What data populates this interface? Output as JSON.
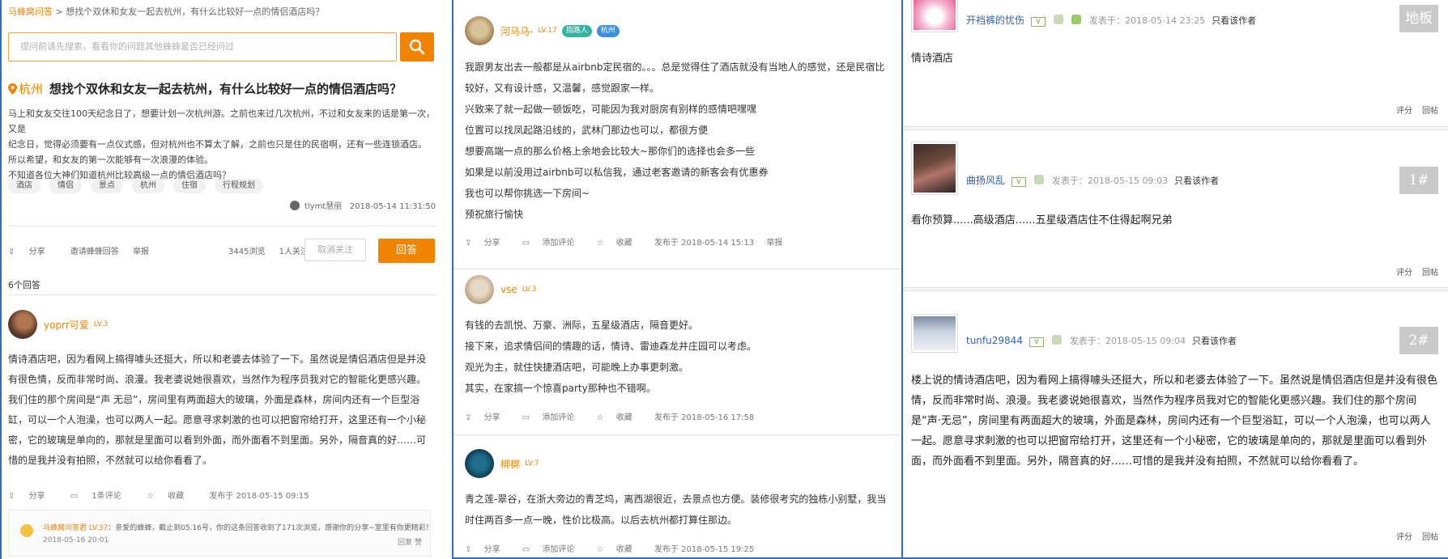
{
  "panel1": {
    "breadcrumb_home": "马蜂窝问答",
    "breadcrumb_rest": " > 想找个双休和女友一起去杭州，有什么比较好一点的情侣酒店吗？",
    "search_placeholder": "提问前请先搜索，看看你的问题其他蜂蜂是否已经问过",
    "question_city": "杭州",
    "question_title": "想找个双休和女友一起去杭州，有什么比较好一点的情侣酒店吗？",
    "question_lines": [
      "马上和女友交往100天纪念日了，想要计划一次杭州游。之前也来过几次杭州，不过和女友来的话是第一次，又是",
      "纪念日，觉得必须要有一点仪式感，但对杭州也不算太了解，之前也只是住的民宿啊，还有一些连锁酒店。",
      "所以希望，和女友的第一次能够有一次浪漫的体验。",
      "不知道各位大神们知道杭州比较高级一点的情侣酒店吗？"
    ],
    "tags": [
      "酒店",
      "情侣",
      "景点",
      "杭州",
      "住宿",
      "行程规划"
    ],
    "asker_name": "tlymt慧丽",
    "asker_time": "2018-05-14 11:31:50",
    "actions": [
      "分享",
      "邀请蜂蜂回答",
      "举报"
    ],
    "views": "3445浏览",
    "followers": "1人关注",
    "unfollow_label": "取消关注",
    "answer_label": "回答",
    "answer_count": "6个回答",
    "answer": {
      "user": "yoprr可爱",
      "level": "LV.3",
      "lines": [
        "情诗酒店吧，因为看网上搞得噱头还挺大，所以和老婆去体验了一下。虽然说是情侣酒店但是并没",
        "有很色情，反而非常时尚、浪漫。我老婆说她很喜欢，当然作为程序员我对它的智能化更感兴趣。",
        "我们住的那个房间是“声 无忌”，房间里有两面超大的玻璃，外面是森林，房间内还有一个巨型浴",
        "缸，可以一个人泡澡，也可以两人一起。愿意寻求刺激的也可以把窗帘给打开，这里还有一个小秘",
        "密，它的玻璃是单向的，那就是里面可以看到外面，而外面看不到里面。另外，隔音真的好……可",
        "惜的是我并没有拍照，不然就可以给你看看了。"
      ],
      "actions": [
        "分享",
        "1条评论",
        "收藏",
        "发布于 2018-05-15 09:15"
      ],
      "reply_name": "马蜂窝问答君",
      "reply_level": "LV.37",
      "reply_text": "：亲爱的蜂蜂，截止到05.16号，你的这条回答收到了171次浏览，感谢你的分享~室里有你更精彩！",
      "reply_date": "2018-05-16 20:01",
      "reply_ops": "回复  赞"
    }
  },
  "panel2": {
    "answers": [
      {
        "user": "河马马-",
        "level": "LV.17",
        "badges": [
          "指路人",
          "杭州"
        ],
        "lines": [
          "我跟男友出去一般都是从airbnb定民宿的。。。总是觉得住了酒店就没有当地人的感觉，还是民宿比",
          "较好，又有设计感，又温馨，感觉跟家一样。",
          "兴致来了就一起做一顿饭吃，可能因为我对厨房有别样的感情吧嘿嘿",
          "位置可以找凤起路沿线的，武林门那边也可以，都很方便",
          "想要高端一点的那么价格上余地会比较大~那你们的选择也会多一些",
          "如果是以前没用过airbnb可以私信我，通过老客邀请的新客会有优惠券",
          "我也可以帮你挑选一下房间~",
          "预祝旅行愉快"
        ],
        "actions": [
          "分享",
          "添加评论",
          "收藏",
          "发布于 2018-05-14 15:13",
          "举报"
        ]
      },
      {
        "user": "vse",
        "level": "LV.3",
        "lines": [
          "有钱的去凯悦、万豪、洲际，五星级酒店，隔音更好。",
          "接下来，追求情侣间的情趣的话，情诗、雷迪森龙井庄园可以考虑。",
          "观光为主，就住快捷酒店吧，可能晚上办事更刺激。",
          "其实，在家搞一个惊喜party那种也不错啊。"
        ],
        "actions": [
          "分享",
          "添加评论",
          "收藏",
          "发布于 2018-05-16 17:58"
        ]
      },
      {
        "user": "梆梆",
        "level": "LV.7",
        "lines": [
          "青之莲-翠谷，在浙大旁边的青芝坞，离西湖很近，去景点也方便。装修很考究的独栋小别墅，我当",
          "时住两百多一点一晚，性价比极高。以后去杭州都打算住那边。"
        ],
        "actions": [
          "分享",
          "添加评论",
          "收藏",
          "发布于 2018-05-15 19:25"
        ]
      }
    ]
  },
  "panel3": {
    "floors": [
      {
        "user": "开裆裤的忧伤",
        "posted": "发表于：2018-05-14 23:25",
        "only_author": "只看该作者",
        "floor": "地板",
        "text": "情诗酒店",
        "ops": [
          "评分",
          "回帖"
        ]
      },
      {
        "user": "曲扬风乱",
        "posted": "发表于：2018-05-15 09:03",
        "only_author": "只看该作者",
        "floor": "1#",
        "text": "看你预算......高级酒店......五星级酒店住不住得起啊兄弟",
        "ops": [
          "评分",
          "回帖"
        ]
      },
      {
        "user": "tunfu29844",
        "posted": "发表于：2018-05-15 09:04",
        "only_author": "只看该作者",
        "floor": "2#",
        "text": "楼上说的情诗酒店吧，因为看网上搞得噱头还挺大，所以和老婆去体验了一下。虽然说是情侣酒店但是并没有很色情，反而非常时尚、浪漫。我老婆说她很喜欢，当然作为程序员我对它的智能化更感兴趣。我们住的那个房间是“声·无忌”，房间里有两面超大的玻璃，外面是森林，房间内还有一个巨型浴缸，可以一个人泡澡，也可以两人一起。愿意寻求刺激的也可以把窗帘给打开，这里还有一个小秘密，它的玻璃是单向的，那就是里面可以看到外面，而外面看不到里面。另外，隔音真的好……可惜的是我并没有拍照，不然就可以给你看看了。",
        "ops": [
          "评分",
          "回帖"
        ]
      }
    ]
  },
  "colors": {
    "accent": "#f08300",
    "link_blue": "#3163b0",
    "frame_blue": "#2c6fbf"
  },
  "icons": [
    "search-icon",
    "location-pin-icon",
    "share-icon",
    "comment-icon",
    "star-icon",
    "like-icon"
  ]
}
